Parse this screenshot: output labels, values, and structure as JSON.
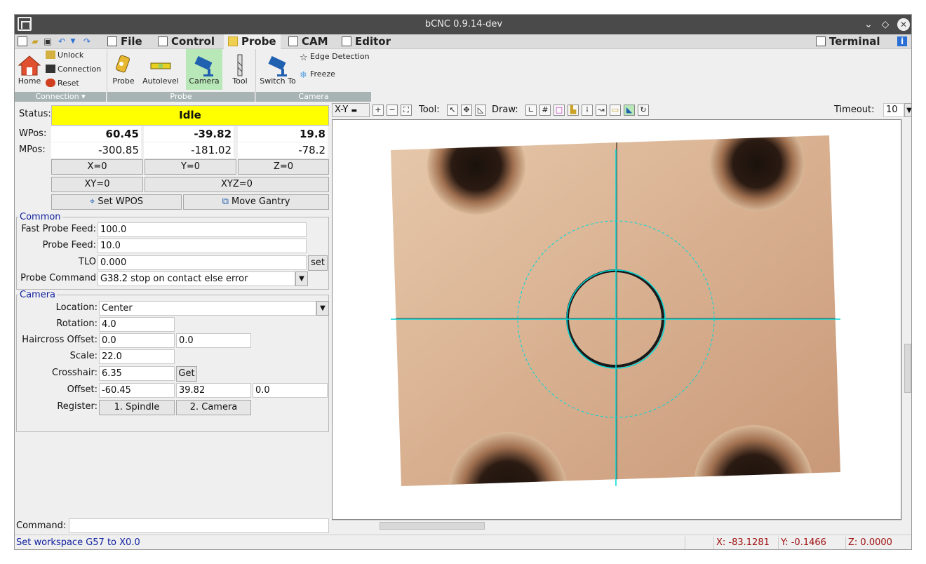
{
  "window": {
    "title": "bCNC 0.9.14-dev"
  },
  "menu": {
    "tabs": [
      "File",
      "Control",
      "Probe",
      "CAM",
      "Editor"
    ],
    "active_tab": "Probe",
    "terminal": "Terminal"
  },
  "ribbon": {
    "connection": {
      "home": "Home",
      "unlock": "Unlock",
      "connection": "Connection",
      "reset": "Reset",
      "group": "Connection ▾"
    },
    "probe": {
      "probe": "Probe",
      "autolevel": "Autolevel",
      "camera": "Camera",
      "tool": "Tool",
      "group": "Probe"
    },
    "camera": {
      "switch_to": "Switch To",
      "edge_detection": "Edge Detection",
      "freeze": "Freeze",
      "group": "Camera"
    }
  },
  "status": {
    "label": "Status:",
    "value": "Idle",
    "color": "#ffff00"
  },
  "position": {
    "wpos_label": "WPos:",
    "mpos_label": "MPos:",
    "wpos": [
      "60.45",
      "-39.82",
      "19.8"
    ],
    "mpos": [
      "-300.85",
      "-181.02",
      "-78.2"
    ]
  },
  "zero_buttons": {
    "x": "X=0",
    "y": "Y=0",
    "z": "Z=0",
    "xy": "XY=0",
    "xyz": "XYZ=0",
    "set_wpos": "Set WPOS",
    "move_gantry": "Move Gantry"
  },
  "common": {
    "title": "Common",
    "fast_probe_feed_label": "Fast Probe Feed:",
    "fast_probe_feed": "100.0",
    "probe_feed_label": "Probe Feed:",
    "probe_feed": "10.0",
    "tlo_label": "TLO",
    "tlo": "0.000",
    "set": "set",
    "probe_command_label": "Probe Command",
    "probe_command": "G38.2 stop on contact else error"
  },
  "camera": {
    "title": "Camera",
    "location_label": "Location:",
    "location": "Center",
    "rotation_label": "Rotation:",
    "rotation": "4.0",
    "haircross_label": "Haircross Offset:",
    "haircross_x": "0.0",
    "haircross_y": "0.0",
    "scale_label": "Scale:",
    "scale": "22.0",
    "crosshair_label": "Crosshair:",
    "crosshair": "6.35",
    "get": "Get",
    "offset_label": "Offset:",
    "offset_x": "-60.45",
    "offset_y": "39.82",
    "offset_z": "0.0",
    "register_label": "Register:",
    "spindle": "1. Spindle",
    "camera_btn": "2. Camera"
  },
  "command": {
    "label": "Command:",
    "value": ""
  },
  "canvas_toolbar": {
    "view": "X-Y",
    "tool_label": "Tool:",
    "draw_label": "Draw:",
    "timeout_label": "Timeout:",
    "timeout": "10"
  },
  "statusbar": {
    "message": "Set workspace G57 to X0.0",
    "x": "X: -83.1281",
    "y": "Y: -0.1466",
    "z": "Z: 0.0000"
  }
}
